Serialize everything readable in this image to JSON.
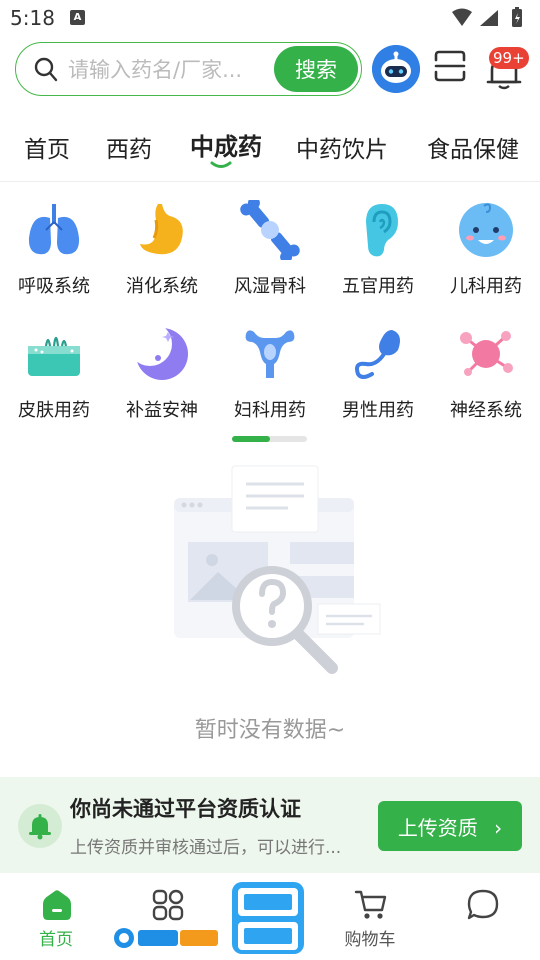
{
  "status_bar": {
    "time": "5:18",
    "a_icon": "A"
  },
  "search": {
    "placeholder": "请输入药名/厂家...",
    "button_label": "搜索"
  },
  "header": {
    "badge_count": "99+"
  },
  "tabs": [
    {
      "label": "首页"
    },
    {
      "label": "西药"
    },
    {
      "label": "中成药"
    },
    {
      "label": "中药饮片"
    },
    {
      "label": "食品保健"
    }
  ],
  "active_tab": "中成药",
  "categories": [
    {
      "label": "呼吸系统",
      "icon": "lungs-icon"
    },
    {
      "label": "消化系统",
      "icon": "stomach-icon"
    },
    {
      "label": "风湿骨科",
      "icon": "bone-joint-icon"
    },
    {
      "label": "五官用药",
      "icon": "ear-icon"
    },
    {
      "label": "儿科用药",
      "icon": "baby-icon"
    },
    {
      "label": "皮肤用药",
      "icon": "skin-icon"
    },
    {
      "label": "补益安神",
      "icon": "moon-icon"
    },
    {
      "label": "妇科用药",
      "icon": "uterus-icon"
    },
    {
      "label": "男性用药",
      "icon": "male-icon"
    },
    {
      "label": "神经系统",
      "icon": "neuron-icon"
    }
  ],
  "category_scroll_position": 0.5,
  "empty_state": {
    "text": "暂时没有数据~"
  },
  "notice": {
    "title": "你尚未通过平台资质认证",
    "subtitle": "上传资质并审核通过后，可以进行...",
    "button_label": "上传资质",
    "button_chevron": "›"
  },
  "bottom_nav": [
    {
      "label": "首页",
      "icon": "home-icon"
    },
    {
      "label": "",
      "icon": "grid-icon"
    },
    {
      "label": "",
      "icon": "promo-banner-icon"
    },
    {
      "label": "购物车",
      "icon": "cart-icon"
    },
    {
      "label": "",
      "icon": "chat-bubble-icon"
    }
  ],
  "colors": {
    "brand_green": "#35b14a",
    "badge_red": "#e94235",
    "notice_bg": "#eef7ed"
  }
}
